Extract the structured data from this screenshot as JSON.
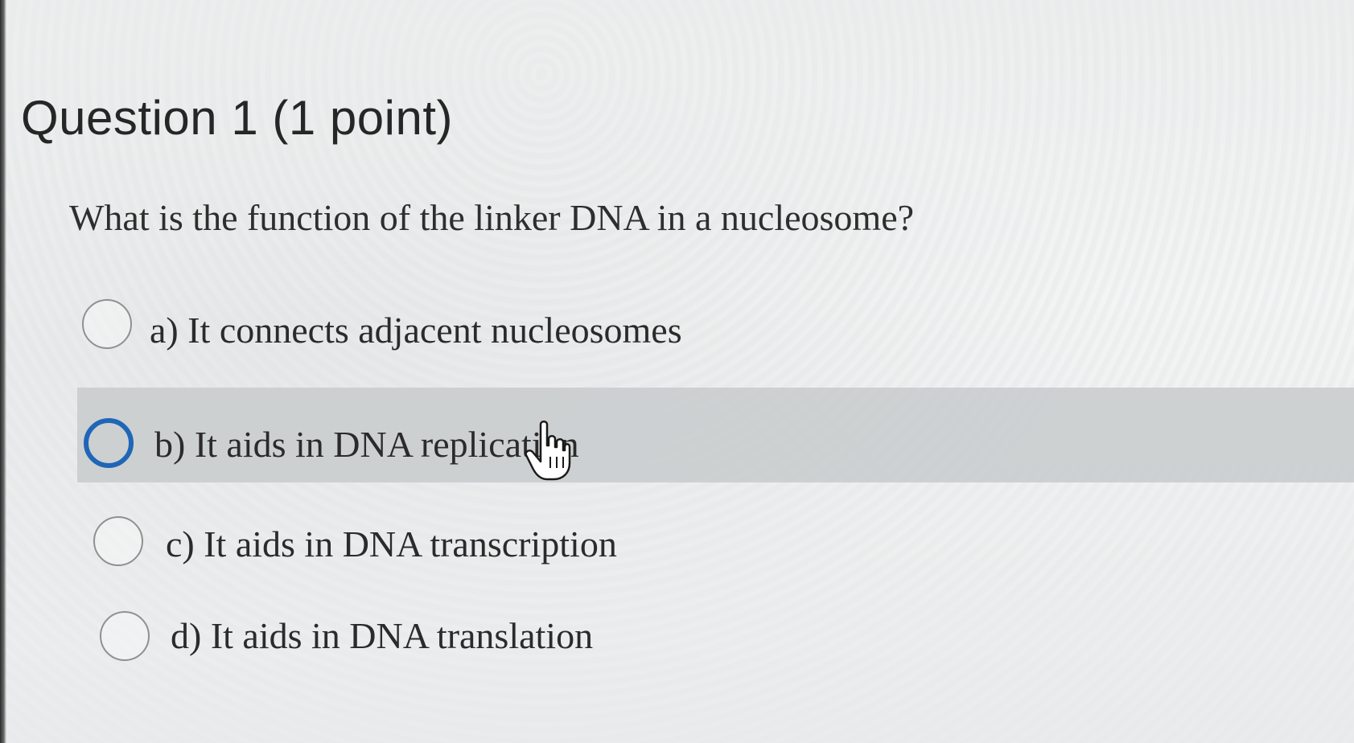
{
  "question": {
    "title": "Question 1 (1 point)",
    "prompt": "What is the function of the linker DNA in a nucleosome?"
  },
  "options": [
    {
      "label": "a) It connects adjacent nucleosomes",
      "selected": false
    },
    {
      "label": "b) It aids in DNA replication",
      "selected": false,
      "hovered": true
    },
    {
      "label": "c) It aids in DNA transcription",
      "selected": false
    },
    {
      "label": "d) It aids in DNA translation",
      "selected": false
    }
  ],
  "colors": {
    "focus_ring": "#1f66b7",
    "hover_row": "#c8cbcd"
  },
  "icons": {
    "cursor": "hand-pointer-icon"
  }
}
